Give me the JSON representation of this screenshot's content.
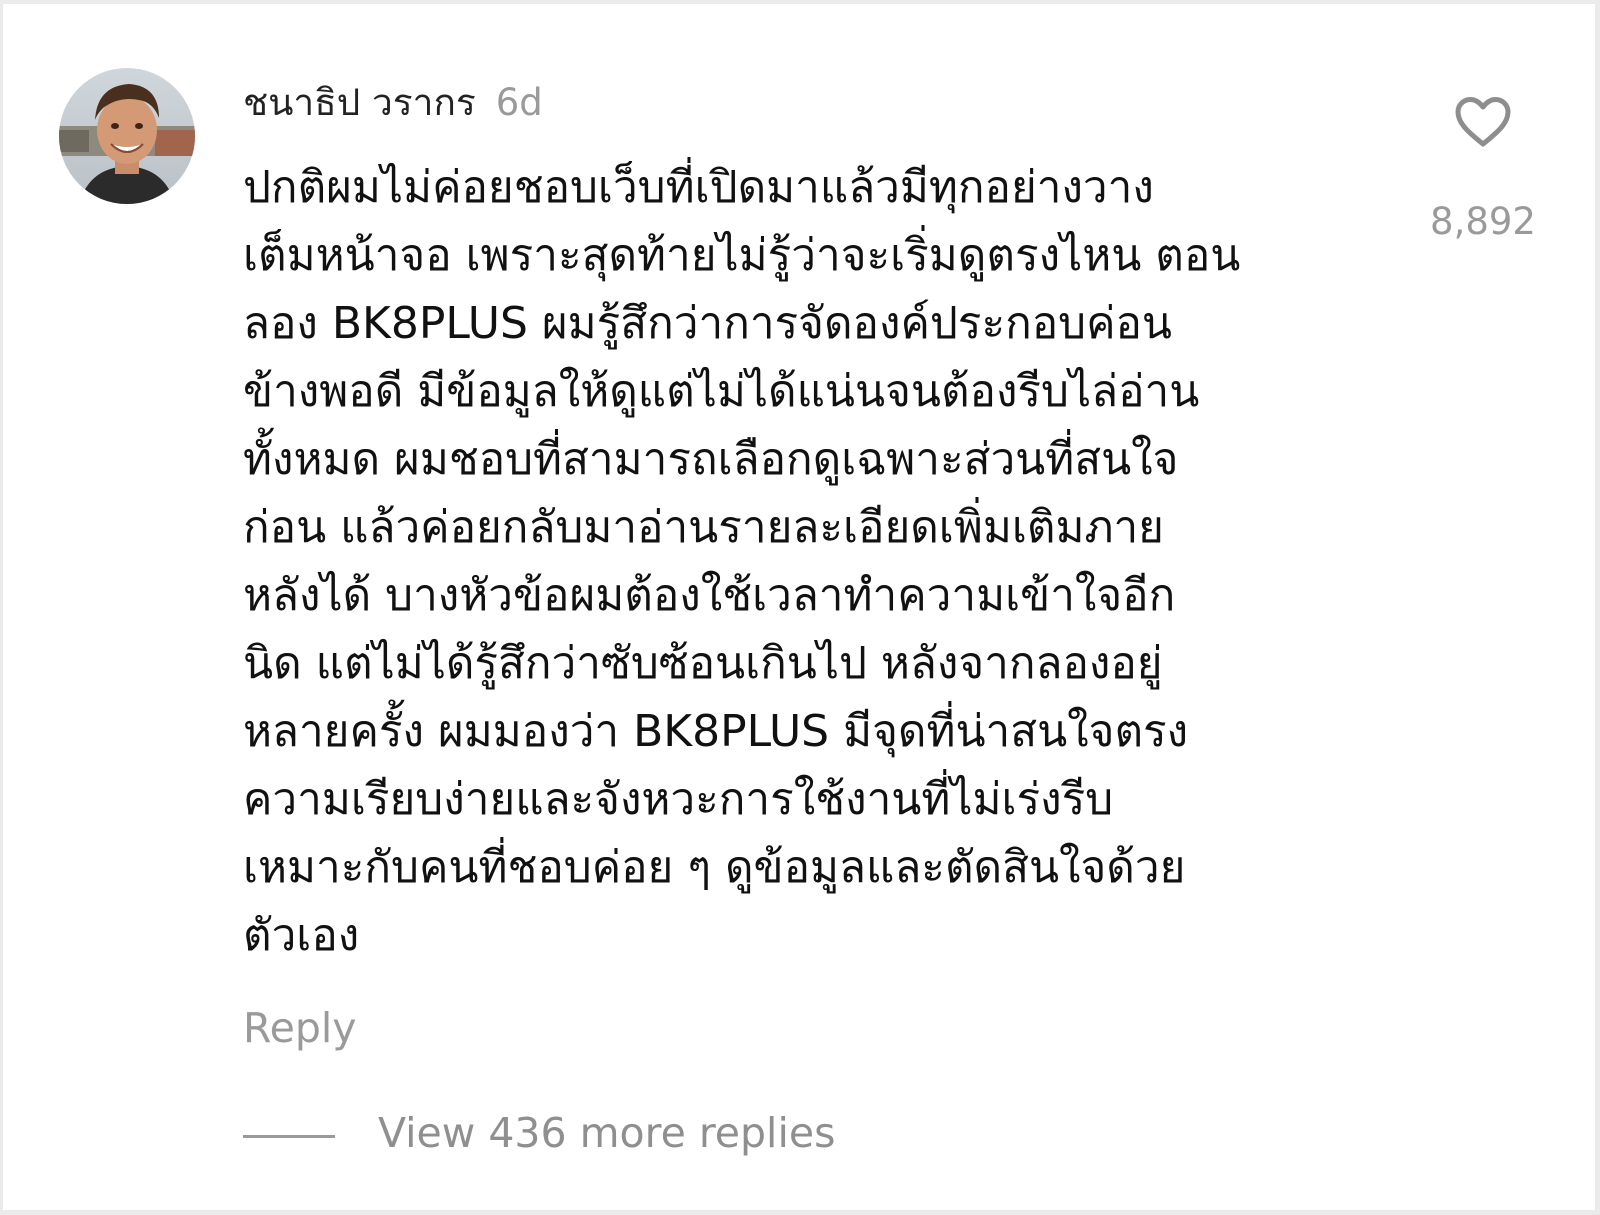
{
  "comment": {
    "username": "ชนาธิป วรากร",
    "time": "6d",
    "lines": [
      "ปกติผมไม่ค่อยชอบเว็บที่เปิดมาแล้วมีทุกอย่างวาง",
      "เต็มหน้าจอ เพราะสุดท้ายไม่รู้ว่าจะเริ่มดูตรงไหน ตอน",
      "ลอง BK8PLUS ผมรู้สึกว่าการจัดองค์ประกอบค่อน",
      "ข้างพอดี มีข้อมูลให้ดูแต่ไม่ได้แน่นจนต้องรีบไล่อ่าน",
      "ทั้งหมด ผมชอบที่สามารถเลือกดูเฉพาะส่วนที่สนใจ",
      "ก่อน แล้วค่อยกลับมาอ่านรายละเอียดเพิ่มเติมภาย",
      "หลังได้ บางหัวข้อผมต้องใช้เวลาทำความเข้าใจอีก",
      "นิด แต่ไม่ได้รู้สึกว่าซับซ้อนเกินไป หลังจากลองอยู่",
      "หลายครั้ง ผมมองว่า BK8PLUS มีจุดที่น่าสนใจตรง",
      "ความเรียบง่ายและจังหวะการใช้งานที่ไม่เร่งรีบ",
      "เหมาะกับคนที่ชอบค่อย ๆ ดูข้อมูลและตัดสินใจด้วย",
      "ตัวเอง"
    ],
    "reply_label": "Reply",
    "like_count": "8,892",
    "like_icon": "heart-outline-icon",
    "view_replies_label": "View 436 more replies"
  },
  "colors": {
    "text_primary": "#111111",
    "text_secondary": "#9a9a9a",
    "background": "#ffffff"
  }
}
